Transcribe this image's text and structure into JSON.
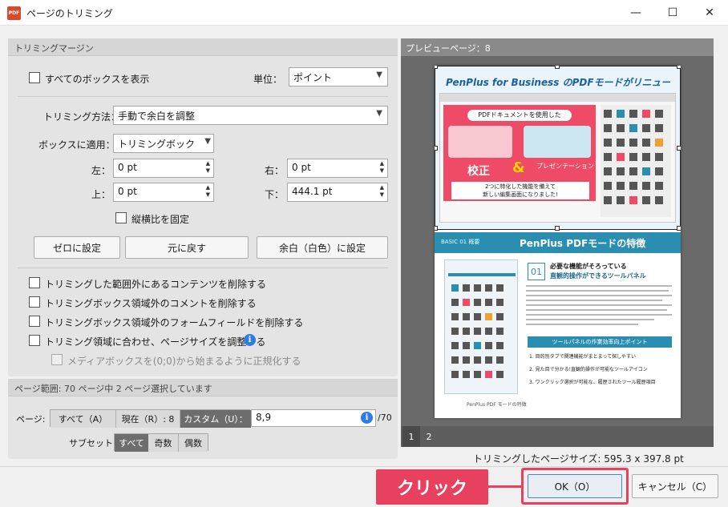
{
  "window": {
    "title": "ページのトリミング",
    "app_icon": "PDF",
    "minimize": "—",
    "maximize": "☐",
    "close": "✕"
  },
  "margins": {
    "section_title": "トリミングマージン",
    "show_all_boxes": "すべてのボックスを表示",
    "unit_label": "単位：",
    "unit_value": "ポイント",
    "method_label": "トリミング方法：",
    "method_value": "手動で余白を調整",
    "apply_label": "ボックスに適用：",
    "apply_value": "トリミングボック",
    "left_label": "左：",
    "left_value": "0 pt",
    "right_label": "右：",
    "right_value": "0 pt",
    "top_label": "上：",
    "top_value": "0 pt",
    "bottom_label": "下：",
    "bottom_value": "444.1 pt",
    "keep_ratio": "縦横比を固定",
    "zero_button": "ゼロに設定",
    "revert_button": "元に戻す",
    "white_margin_button": "余白（白色）に設定",
    "opt1": "トリミングした範囲外にあるコンテンツを削除する",
    "opt2": "トリミングボックス領域外のコメントを削除する",
    "opt3": "トリミングボックス領域外のフォームフィールドを削除する",
    "opt4": "トリミング領域に合わせ、ページサイズを調整する",
    "opt5": "メディアボックスを(0;0)から始まるように正規化する",
    "info_icon": "i"
  },
  "range": {
    "section_title": "ページ範囲: 70 ページ中 2 ページ選択しています",
    "page_label": "ページ:",
    "all": "すべて（A）",
    "current": "現在（R）: 8",
    "custom": "カスタム（U）：",
    "custom_value": "8,9",
    "total": "/70",
    "subset_label": "サブセット:",
    "subset_all": "すべて",
    "subset_odd": "奇数",
    "subset_even": "偶数"
  },
  "preview": {
    "header": "プレビューページ：8",
    "tab1": "1",
    "tab2": "2",
    "size_text": "トリミングしたページサイズ: 595.3 x 397.8 pt",
    "banner_title": "PenPlus for Business のPDFモードがリニューアル!",
    "pill_text": "PDFドキュメントを使用した",
    "left_badge": "校正",
    "amp": "&",
    "right_badge": "プレゼンテーション",
    "caption1": "2つに特化した機能を備えて",
    "caption2": "新しい編集画面になりました!",
    "band_small": "BASIC 01  概要",
    "band_title": "PenPlus PDFモードの特徴",
    "section_no": "01",
    "section_head1": "必要な機能がそろっている",
    "section_head2": "直観的操作ができるツールパネル",
    "subhead": "ツールパネルの作業効率向上ポイント",
    "point1": "1. 目的別タブで関連機能がまとまって探しやすい",
    "point2": "2. 見た目で分かる!直観的操作が可能なツールアイコン",
    "point3": "3. ワンクリック選択が可能な、履歴されたツール履歴項目",
    "footer_text": "PenPlus PDF モードの特徴"
  },
  "footer": {
    "click_label": "クリック",
    "ok_button": "OK（O）",
    "cancel_button": "キャンセル（C）"
  },
  "colors": {
    "accent": "#e8405f",
    "teal": "#2a8eb0",
    "banner": "#ef4b66"
  }
}
